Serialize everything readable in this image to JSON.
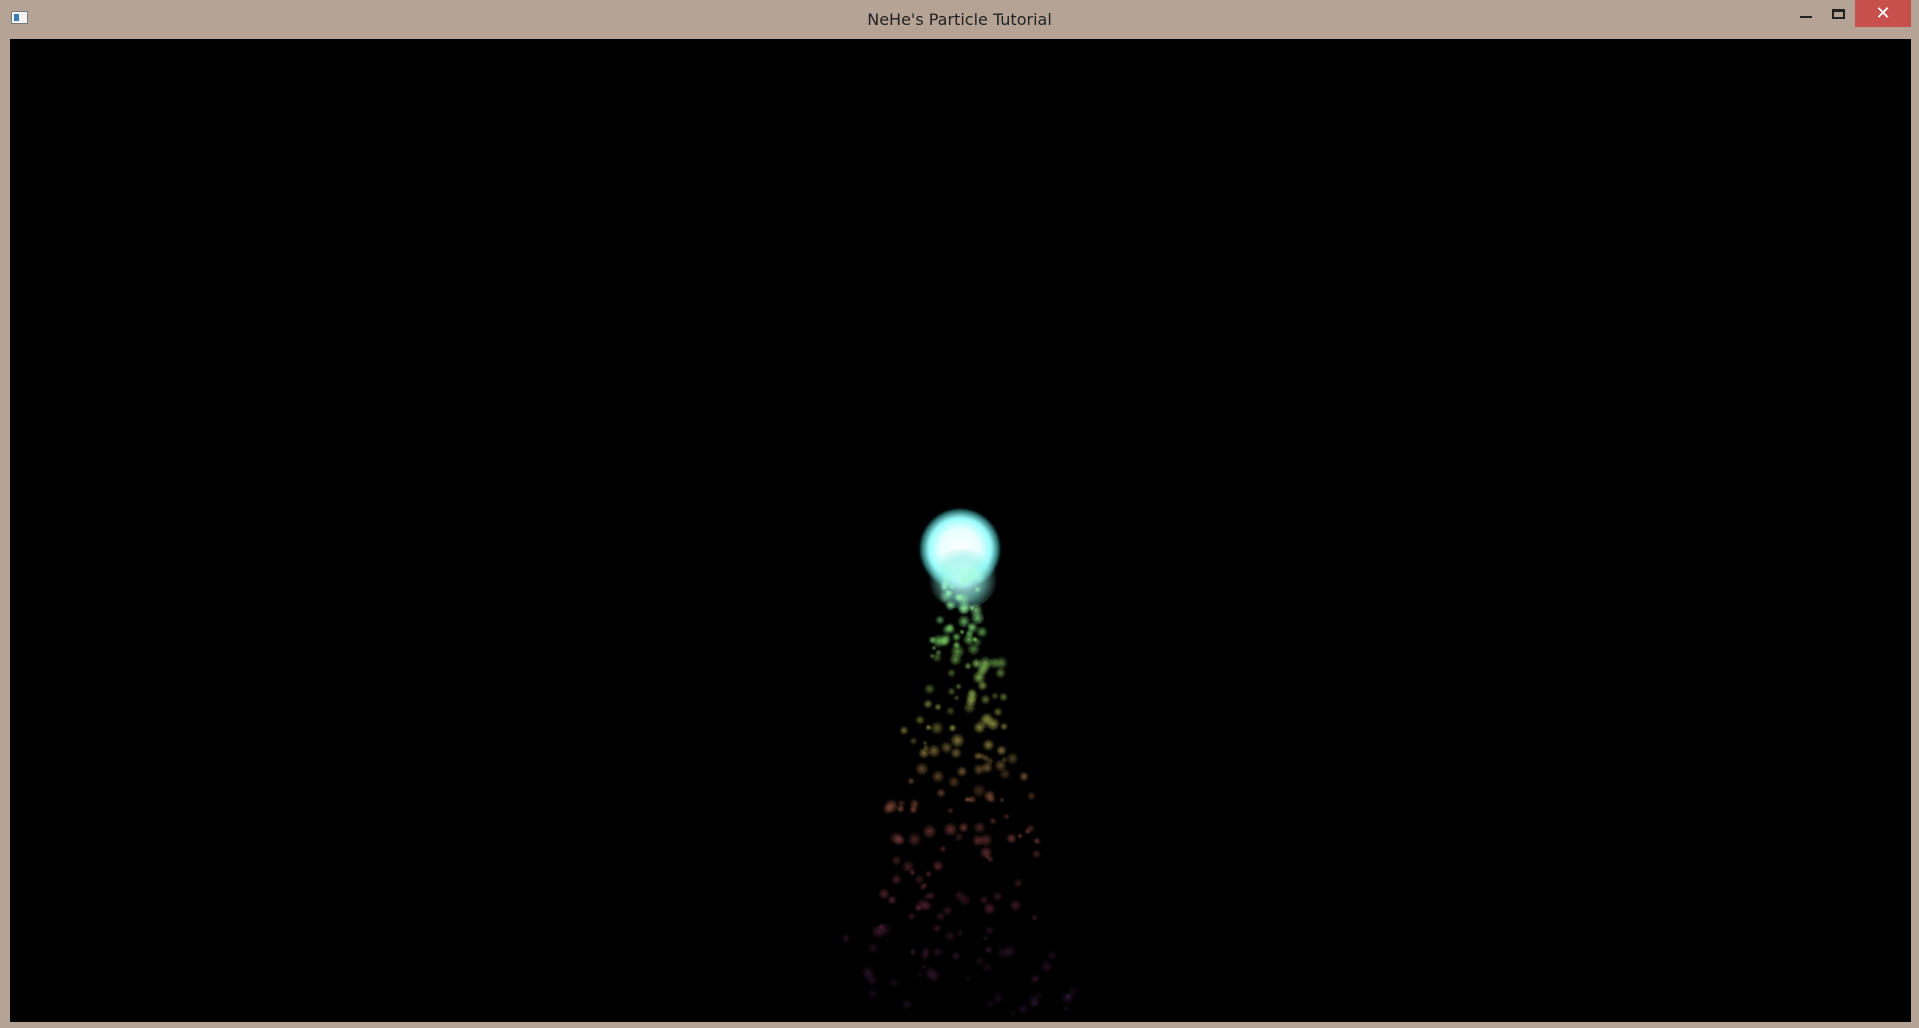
{
  "window": {
    "title": "NeHe's Particle Tutorial",
    "app_icon": "window-app-icon",
    "controls": {
      "minimize_icon": "minimize-icon",
      "maximize_icon": "maximize-icon",
      "close_icon": "close-icon",
      "close_glyph": "✕"
    },
    "colors": {
      "titlebar": "#b5a395",
      "close_button": "#c7504c",
      "canvas_background": "#000000"
    }
  },
  "scene": {
    "description_colors": {
      "core": "#ffffff",
      "upper": "#7fe27a",
      "middle": "#c9c45a",
      "lower": "#c8546b",
      "bottom": "#7a3a7a"
    }
  }
}
